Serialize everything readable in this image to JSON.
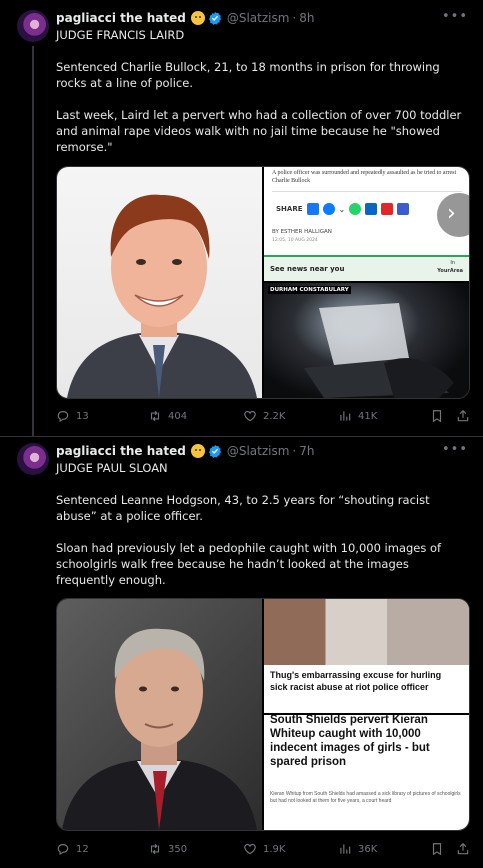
{
  "posts": [
    {
      "author": "pagliacci the hated",
      "handle": "@Slatzism",
      "separator": "·",
      "time": "8h",
      "body": "JUDGE FRANCIS LAIRD\n\nSentenced Charlie Bullock, 21, to 18 months in prison for throwing rocks at a line of police.\n\nLast week, Laird let a pervert who had a collection of over 700 toddler and animal rape videos walk with no jail time because he \"showed remorse.\"",
      "media": {
        "article_snippet": "A police officer was surrounded and repeatedly assaulted as he tried to arrest Charlie Bullock",
        "share_label": "SHARE",
        "byline": "BY ESTHER HALLIGAN",
        "dateline": "12:05, 10 AUG 2024",
        "news_near_you": "See news near you",
        "your_area_top": "In",
        "your_area": "YourArea",
        "constabulary": "DURHAM CONSTABULARY"
      },
      "stats": {
        "replies": "13",
        "reposts": "404",
        "likes": "2.2K",
        "views": "41K"
      }
    },
    {
      "author": "pagliacci the hated",
      "handle": "@Slatzism",
      "separator": "·",
      "time": "7h",
      "body": "JUDGE PAUL SLOAN\n\nSentenced Leanne Hodgson, 43, to 2.5 years for “shouting racist abuse” at a police officer.\n\nSloan had previously let a pedophile caught with 10,000 images of schoolgirls walk free because he hadn’t looked at the images frequently enough.",
      "media": {
        "headline_top": "Thug's embarrassing excuse for hurling sick racist abuse at riot police officer",
        "headline_bottom": "South Shields pervert Kieran Whiteup caught with 10,000 indecent images of girls - but spared prison",
        "bottom_snippet": "Kieran Whitup from South Shields had amassed a sick library of pictures of schoolgirls but had not looked at them for five years, a court heard"
      },
      "stats": {
        "replies": "12",
        "reposts": "350",
        "likes": "1.9K",
        "views": "36K"
      }
    }
  ],
  "colors": {
    "verified": "#1d9bf0",
    "muted": "#71767b",
    "text": "#e7e9ea",
    "border": "#2f3336"
  }
}
